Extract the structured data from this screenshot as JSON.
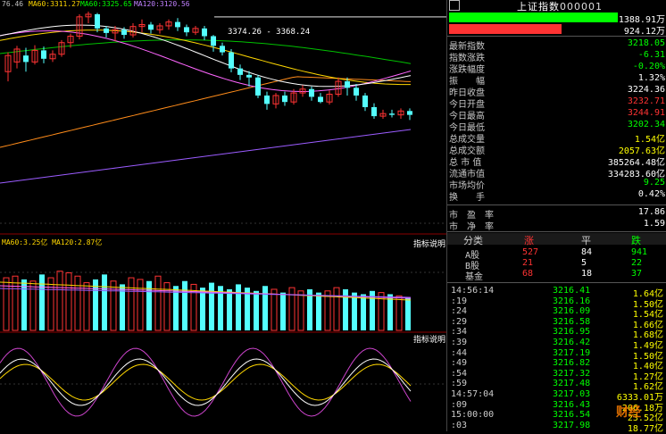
{
  "price_chart": {
    "ma_labels": [
      "76.46",
      "MA60:3311.27",
      "MA60:3325.65",
      "MA120:3120.56"
    ],
    "range_label": "3374.26 - 3368.24",
    "candles": [
      [
        3285,
        3310,
        3270,
        3315
      ],
      [
        3300,
        3320,
        3290,
        3325
      ],
      [
        3310,
        3300,
        3285,
        3322
      ],
      [
        3300,
        3318,
        3296,
        3326
      ],
      [
        3318,
        3305,
        3298,
        3324
      ],
      [
        3305,
        3312,
        3300,
        3318
      ],
      [
        3312,
        3330,
        3308,
        3334
      ],
      [
        3330,
        3340,
        3322,
        3344
      ],
      [
        3340,
        3370,
        3335,
        3374
      ],
      [
        3370,
        3374,
        3360,
        3378
      ],
      [
        3374,
        3352,
        3346,
        3376
      ],
      [
        3352,
        3345,
        3338,
        3356
      ],
      [
        3345,
        3350,
        3332,
        3356
      ],
      [
        3350,
        3342,
        3336,
        3354
      ],
      [
        3342,
        3355,
        3338,
        3360
      ],
      [
        3355,
        3358,
        3346,
        3366
      ],
      [
        3358,
        3350,
        3344,
        3362
      ],
      [
        3350,
        3356,
        3344,
        3360
      ],
      [
        3356,
        3362,
        3350,
        3366
      ],
      [
        3362,
        3354,
        3348,
        3368
      ],
      [
        3354,
        3346,
        3340,
        3358
      ],
      [
        3346,
        3352,
        3342,
        3356
      ],
      [
        3352,
        3340,
        3334,
        3356
      ],
      [
        3340,
        3325,
        3316,
        3342
      ],
      [
        3325,
        3315,
        3310,
        3330
      ],
      [
        3315,
        3290,
        3284,
        3320
      ],
      [
        3290,
        3280,
        3272,
        3296
      ],
      [
        3280,
        3276,
        3262,
        3286
      ],
      [
        3276,
        3248,
        3244,
        3280
      ],
      [
        3248,
        3235,
        3226,
        3254
      ],
      [
        3235,
        3248,
        3228,
        3252
      ],
      [
        3248,
        3238,
        3232,
        3254
      ],
      [
        3238,
        3252,
        3234,
        3258
      ],
      [
        3252,
        3258,
        3246,
        3264
      ],
      [
        3258,
        3246,
        3240,
        3262
      ],
      [
        3246,
        3238,
        3236,
        3252
      ],
      [
        3238,
        3250,
        3234,
        3256
      ],
      [
        3250,
        3270,
        3246,
        3276
      ],
      [
        3270,
        3260,
        3248,
        3276
      ],
      [
        3260,
        3248,
        3240,
        3266
      ],
      [
        3248,
        3230,
        3224,
        3252
      ],
      [
        3230,
        3216,
        3212,
        3236
      ],
      [
        3216,
        3220,
        3212,
        3226
      ],
      [
        3220,
        3218,
        3214,
        3226
      ],
      [
        3218,
        3224,
        3212,
        3228
      ],
      [
        3224,
        3218,
        3210,
        3228
      ]
    ]
  },
  "volume_panel": {
    "ma_label": "MA60:3.25亿  MA120:2.87亿",
    "link": "指标说明",
    "volumes": [
      3.2,
      3.3,
      3.1,
      3.0,
      3.4,
      3.2,
      3.6,
      3.5,
      3.3,
      2.9,
      3.1,
      3.4,
      3.0,
      2.8,
      3.2,
      3.1,
      3.0,
      3.3,
      2.9,
      2.7,
      3.0,
      2.8,
      2.6,
      2.9,
      2.7,
      2.5,
      2.8,
      2.6,
      2.4,
      2.7,
      2.5,
      2.3,
      2.6,
      2.4,
      2.5,
      2.3,
      2.4,
      2.6,
      2.5,
      2.3,
      2.2,
      2.4,
      2.3,
      2.2,
      2.1,
      2.0
    ]
  },
  "oscillator_panel": {
    "link": "指标说明"
  },
  "header": {
    "icon": "grid-icon",
    "title": "上证指数",
    "code": "000001"
  },
  "power_bars": [
    {
      "value": "1388.91万",
      "color": "#00ff00",
      "fraction": 0.78
    },
    {
      "value": "924.12万",
      "color": "#ff3333",
      "fraction": 0.52
    }
  ],
  "stats": [
    {
      "label": "最新指数",
      "value": "3218.05",
      "color": "#00ff00"
    },
    {
      "label": "指数涨跌",
      "value": "-6.31",
      "color": "#00ff00"
    },
    {
      "label": "涨跌幅度",
      "value": "-0.20%",
      "color": "#00ff00"
    },
    {
      "label": "振　　幅",
      "value": "1.32%",
      "color": "#ffffff"
    },
    {
      "label": "昨日收盘",
      "value": "3224.36",
      "color": "#ffffff"
    },
    {
      "label": "今日开盘",
      "value": "3232.71",
      "color": "#ff3333"
    },
    {
      "label": "今日最高",
      "value": "3244.91",
      "color": "#ff3333"
    },
    {
      "label": "今日最低",
      "value": "3202.34",
      "color": "#00ff00"
    },
    {
      "label": "总成交量",
      "value": "1.54亿",
      "color": "#ffff00"
    },
    {
      "label": "总成交额",
      "value": "2057.63亿",
      "color": "#ffff00"
    },
    {
      "label": "总 市 值",
      "value": "385264.48亿",
      "color": "#ffffff"
    },
    {
      "label": "流通市值",
      "value": "334283.60亿",
      "color": "#ffffff"
    },
    {
      "label": "市场均价",
      "value": "9.25",
      "color": "#00ff00"
    },
    {
      "label": "换　　手",
      "value": "0.42%",
      "color": "#ffffff"
    }
  ],
  "ratios": [
    {
      "label": "市　盈　率",
      "value": "17.86",
      "color": "#ffffff"
    },
    {
      "label": "市　净　率",
      "value": "1.59",
      "color": "#ffffff"
    }
  ],
  "breadth": {
    "headers": [
      "分类",
      "涨",
      "平",
      "跌"
    ],
    "rows": [
      {
        "name": "A股",
        "up": "527",
        "flat": "84",
        "down": "941"
      },
      {
        "name": "B股",
        "up": "21",
        "flat": "5",
        "down": "22"
      },
      {
        "name": "基金",
        "up": "68",
        "flat": "18",
        "down": "37"
      }
    ]
  },
  "ticks": [
    {
      "time": "14:56:14",
      "price": "3216.41",
      "vol": "1.64亿"
    },
    {
      "time": ":19",
      "price": "3216.16",
      "vol": "1.50亿"
    },
    {
      "time": ":24",
      "price": "3216.09",
      "vol": "1.54亿"
    },
    {
      "time": ":29",
      "price": "3216.58",
      "vol": "1.66亿"
    },
    {
      "time": ":34",
      "price": "3216.95",
      "vol": "1.68亿"
    },
    {
      "time": ":39",
      "price": "3216.42",
      "vol": "1.49亿"
    },
    {
      "time": ":44",
      "price": "3217.19",
      "vol": "1.50亿"
    },
    {
      "time": ":49",
      "price": "3216.82",
      "vol": "1.40亿"
    },
    {
      "time": ":54",
      "price": "3217.32",
      "vol": "1.27亿"
    },
    {
      "time": ":59",
      "price": "3217.48",
      "vol": "1.62亿"
    },
    {
      "time": "14:57:04",
      "price": "3217.03",
      "vol": "6333.01万"
    },
    {
      "time": ":09",
      "price": "3216.43",
      "vol": "206.18万"
    },
    {
      "time": "15:00:00",
      "price": "3216.54",
      "vol": "23.52亿"
    },
    {
      "time": ":03",
      "price": "3217.98",
      "vol": "18.77亿"
    }
  ],
  "watermark": "财经频道"
}
